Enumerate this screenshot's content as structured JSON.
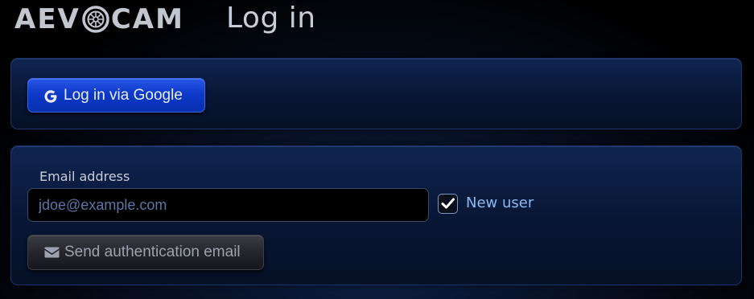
{
  "header": {
    "logo_left": "AEV",
    "logo_right": "CAM",
    "title": "Log in"
  },
  "google_card": {
    "button_label": "Log in via Google",
    "icon": "google-g-icon"
  },
  "email_card": {
    "label": "Email address",
    "input_value": "",
    "input_placeholder": "jdoe@example.com",
    "new_user_checked": true,
    "new_user_label": "New user",
    "send_button_label": "Send authentication email",
    "send_icon": "envelope-icon"
  },
  "colors": {
    "background": "#000000",
    "card_top": "#0f2450",
    "google_button": "#0e39c9",
    "new_user_label": "#8cbaf0",
    "send_button": "#24262c"
  }
}
